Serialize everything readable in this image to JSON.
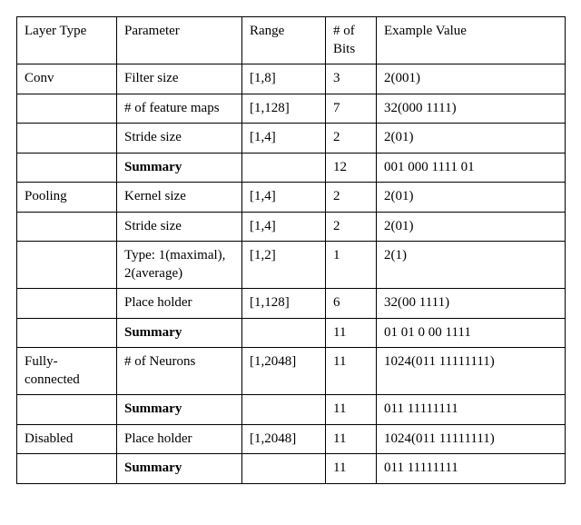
{
  "headers": {
    "layer_type": "Layer Type",
    "parameter": "Parameter",
    "range": "Range",
    "bits": "# of Bits",
    "example": "Example Value"
  },
  "rows": [
    {
      "layer_type": "Conv",
      "parameter": "Filter size",
      "range": "[1,8]",
      "bits": "3",
      "example": "2(001)",
      "param_bold": false
    },
    {
      "layer_type": "",
      "parameter": "# of feature maps",
      "range": "[1,128]",
      "bits": "7",
      "example": "32(000 1111)",
      "param_bold": false
    },
    {
      "layer_type": "",
      "parameter": "Stride size",
      "range": "[1,4]",
      "bits": "2",
      "example": "2(01)",
      "param_bold": false
    },
    {
      "layer_type": "",
      "parameter": "Summary",
      "range": "",
      "bits": "12",
      "example": "001 000 1111 01",
      "param_bold": true
    },
    {
      "layer_type": "Pooling",
      "parameter": "Kernel size",
      "range": "[1,4]",
      "bits": "2",
      "example": "2(01)",
      "param_bold": false
    },
    {
      "layer_type": "",
      "parameter": "Stride size",
      "range": "[1,4]",
      "bits": "2",
      "example": "2(01)",
      "param_bold": false
    },
    {
      "layer_type": "",
      "parameter": "Type: 1(maximal), 2(average)",
      "range": "[1,2]",
      "bits": "1",
      "example": "2(1)",
      "param_bold": false
    },
    {
      "layer_type": "",
      "parameter": "Place holder",
      "range": "[1,128]",
      "bits": "6",
      "example": "32(00 1111)",
      "param_bold": false
    },
    {
      "layer_type": "",
      "parameter": "Summary",
      "range": "",
      "bits": "11",
      "example": "01 01 0 00 1111",
      "param_bold": true
    },
    {
      "layer_type": "Fully-connected",
      "parameter": "# of Neurons",
      "range": "[1,2048]",
      "bits": "11",
      "example": "1024(011 11111111)",
      "param_bold": false
    },
    {
      "layer_type": "",
      "parameter": "Summary",
      "range": "",
      "bits": "11",
      "example": "011 11111111",
      "param_bold": true
    },
    {
      "layer_type": "Disabled",
      "parameter": "Place holder",
      "range": "[1,2048]",
      "bits": "11",
      "example": "1024(011 11111111)",
      "param_bold": false
    },
    {
      "layer_type": "",
      "parameter": "Summary",
      "range": "",
      "bits": "11",
      "example": "011 11111111",
      "param_bold": true
    }
  ],
  "chart_data": {
    "type": "table",
    "title": "",
    "columns": [
      "Layer Type",
      "Parameter",
      "Range",
      "# of Bits",
      "Example Value"
    ],
    "data": [
      [
        "Conv",
        "Filter size",
        "[1,8]",
        3,
        "2(001)"
      ],
      [
        "Conv",
        "# of feature maps",
        "[1,128]",
        7,
        "32(000 1111)"
      ],
      [
        "Conv",
        "Stride size",
        "[1,4]",
        2,
        "2(01)"
      ],
      [
        "Conv",
        "Summary",
        "",
        12,
        "001 000 1111 01"
      ],
      [
        "Pooling",
        "Kernel size",
        "[1,4]",
        2,
        "2(01)"
      ],
      [
        "Pooling",
        "Stride size",
        "[1,4]",
        2,
        "2(01)"
      ],
      [
        "Pooling",
        "Type: 1(maximal), 2(average)",
        "[1,2]",
        1,
        "2(1)"
      ],
      [
        "Pooling",
        "Place holder",
        "[1,128]",
        6,
        "32(00 1111)"
      ],
      [
        "Pooling",
        "Summary",
        "",
        11,
        "01 01 0 00 1111"
      ],
      [
        "Fully-connected",
        "# of Neurons",
        "[1,2048]",
        11,
        "1024(011 11111111)"
      ],
      [
        "Fully-connected",
        "Summary",
        "",
        11,
        "011 11111111"
      ],
      [
        "Disabled",
        "Place holder",
        "[1,2048]",
        11,
        "1024(011 11111111)"
      ],
      [
        "Disabled",
        "Summary",
        "",
        11,
        "011 11111111"
      ]
    ]
  }
}
